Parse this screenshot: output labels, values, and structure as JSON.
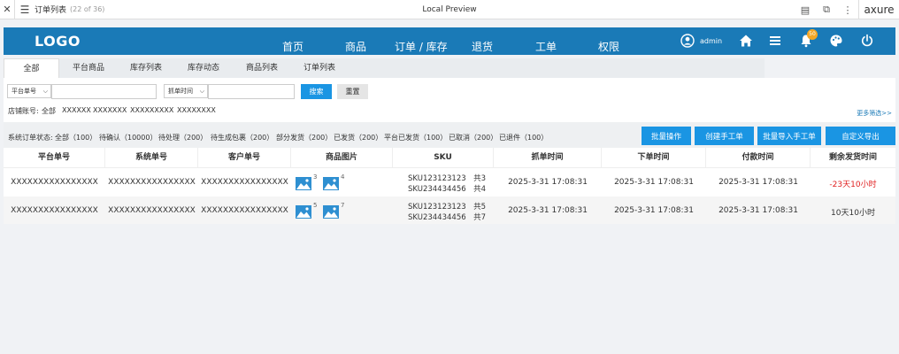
{
  "preview": {
    "page_name": "订单列表",
    "page_count": "(22 of 36)",
    "title": "Local Preview",
    "brand": "axure"
  },
  "header": {
    "logo": "LOGO",
    "nav": [
      "首页",
      "商品",
      "订单 / 库存",
      "退货",
      "工单",
      "权限"
    ],
    "user": "admin",
    "notification_count": "50"
  },
  "tabs": [
    "全部",
    "平台商品",
    "库存列表",
    "库存动态",
    "商品列表",
    "订单列表"
  ],
  "filters": {
    "select1": "平台单号",
    "select2": "抓单时间",
    "search_button": "搜索",
    "reset_button": "重置",
    "shop_label": "店铺账号:",
    "shops": [
      "全部",
      "XXXXXX",
      "XXXXXXX",
      "XXXXXXXXX",
      "XXXXXXXX"
    ],
    "more": "更多筛选>>"
  },
  "status": {
    "label": "系统订单状态:",
    "items": [
      "全部（100）",
      "待确认（10000）",
      "待处理（200）",
      "待生成包裹（200）",
      "部分发货（200）",
      "已发货（200）",
      "平台已发货（100）",
      "已取消（200）",
      "已退件（100）"
    ]
  },
  "actions": [
    "批量操作",
    "创建手工单",
    "批量导入手工单",
    "自定义导出"
  ],
  "table": {
    "columns": [
      "平台单号",
      "系统单号",
      "客户单号",
      "商品图片",
      "SKU",
      "抓单时间",
      "下单时间",
      "付款时间",
      "剩余发货时间"
    ],
    "rows": [
      {
        "platform_no": "XXXXXXXXXXXXXXXX",
        "system_no": "XXXXXXXXXXXXXXXX",
        "customer_no": "XXXXXXXXXXXXXXXX",
        "img_counts": [
          "3",
          "4"
        ],
        "sku1": "SKU123123123　共3",
        "sku2": "SKU234434456　共4",
        "grab_time": "2025-3-31 17:08:31",
        "order_time": "2025-3-31 17:08:31",
        "pay_time": "2025-3-31 17:08:31",
        "remaining": "-23天10小时",
        "remaining_color": "#e02020"
      },
      {
        "platform_no": "XXXXXXXXXXXXXXXX",
        "system_no": "XXXXXXXXXXXXXXXX",
        "customer_no": "XXXXXXXXXXXXXXXX",
        "img_counts": [
          "5",
          "7"
        ],
        "sku1": "SKU123123123　共5",
        "sku2": "SKU234434456　共7",
        "grab_time": "2025-3-31 17:08:31",
        "order_time": "2025-3-31 17:08:31",
        "pay_time": "2025-3-31 17:08:31",
        "remaining": "10天10小时",
        "remaining_color": "#333333"
      }
    ]
  },
  "colors": {
    "brand_blue": "#1a7ab7",
    "button_blue": "#1a95e3",
    "badge": "#f5a623",
    "overdue_red": "#e02020"
  },
  "icons": [
    "close-icon",
    "menu-icon",
    "notes-icon",
    "export-icon",
    "more-icon",
    "user-icon",
    "home-icon",
    "list-icon",
    "bell-icon",
    "palette-icon",
    "power-icon",
    "image-icon"
  ]
}
